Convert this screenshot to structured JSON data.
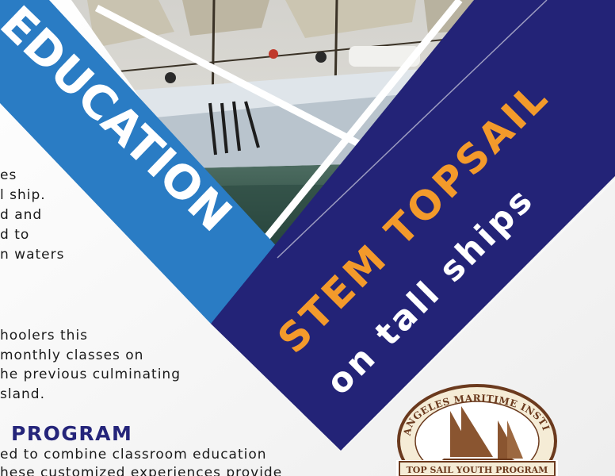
{
  "left_column": {
    "paragraph_1": [
      "es",
      "l ship.",
      "d and",
      "d to",
      "n waters"
    ],
    "paragraph_2": [
      "hoolers this",
      "monthly classes on",
      "he previous culminating",
      "sland."
    ],
    "heading": "PROGRAM",
    "paragraph_3": [
      "ed to combine classroom education",
      "hese customized experiences provide"
    ]
  },
  "banner_light": {
    "text": "T EDUCATION"
  },
  "banner_dark": {
    "title": "STEM TOPSAIL",
    "subtitle": "on tall ships"
  },
  "logo": {
    "top_text": "LOS ANGELES MARITIME INSTITUTE",
    "bottom_text": "TOP SAIL YOUTH PROGRAM"
  },
  "colors": {
    "light_blue": "#2a7cc4",
    "navy": "#232377",
    "orange": "#f39a2b",
    "white": "#ffffff",
    "logo_brown": "#6b3a1e"
  }
}
